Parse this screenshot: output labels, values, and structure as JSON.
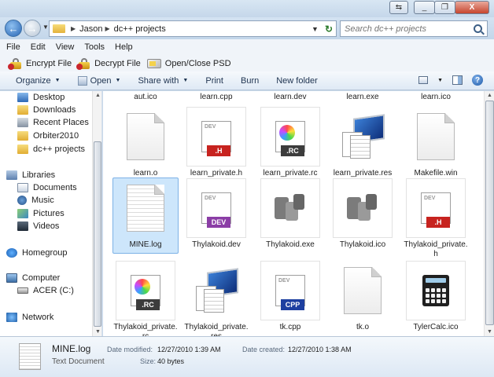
{
  "window": {
    "caption_buttons": [
      "⇆",
      "_",
      "❐",
      "X"
    ]
  },
  "address": {
    "crumbs": [
      "Jason",
      "dc++ projects"
    ],
    "search_placeholder": "Search dc++ projects"
  },
  "menu": [
    "File",
    "Edit",
    "View",
    "Tools",
    "Help"
  ],
  "custom_toolbar": [
    "Encrypt File",
    "Decrypt File",
    "Open/Close PSD"
  ],
  "commandbar": {
    "organize": "Organize",
    "open": "Open",
    "share_with": "Share with",
    "print": "Print",
    "burn": "Burn",
    "new_folder": "New folder"
  },
  "nav": {
    "favorites": [
      "Desktop",
      "Downloads",
      "Recent Places",
      "Orbiter2010",
      "dc++ projects"
    ],
    "libraries_label": "Libraries",
    "libraries": [
      "Documents",
      "Music",
      "Pictures",
      "Videos"
    ],
    "homegroup": "Homegroup",
    "computer": "Computer",
    "drive": "ACER (C:)",
    "network": "Network"
  },
  "files": {
    "top_row": [
      "aut.ico",
      "learn.cpp",
      "learn.dev",
      "learn.exe",
      "learn.ico"
    ],
    "row1": [
      "learn.o",
      "learn_private.h",
      "learn_private.rc",
      "learn_private.res",
      "Makefile.win"
    ],
    "row2": [
      "MINE.log",
      "Thylakoid.dev",
      "Thylakoid.exe",
      "Thylakoid.ico",
      "Thylakoid_private.h"
    ],
    "row3": [
      "Thylakoid_private.rc",
      "Thylakoid_private.res",
      "tk.cpp",
      "tk.o",
      "TylerCalc.ico"
    ],
    "tags": {
      "h": ".H",
      "rc": ".RC",
      "dev": "DEV",
      "cpp": "CPP",
      "dev_title": "DEV"
    }
  },
  "details": {
    "name": "MINE.log",
    "type": "Text Document",
    "modified_label": "Date modified:",
    "modified": "12/27/2010 1:39 AM",
    "created_label": "Date created:",
    "created": "12/27/2010 1:38 AM",
    "size_label": "Size:",
    "size": "40 bytes"
  },
  "colors": {
    "selection": "#cde6fb",
    "accent": "#2865b4"
  }
}
